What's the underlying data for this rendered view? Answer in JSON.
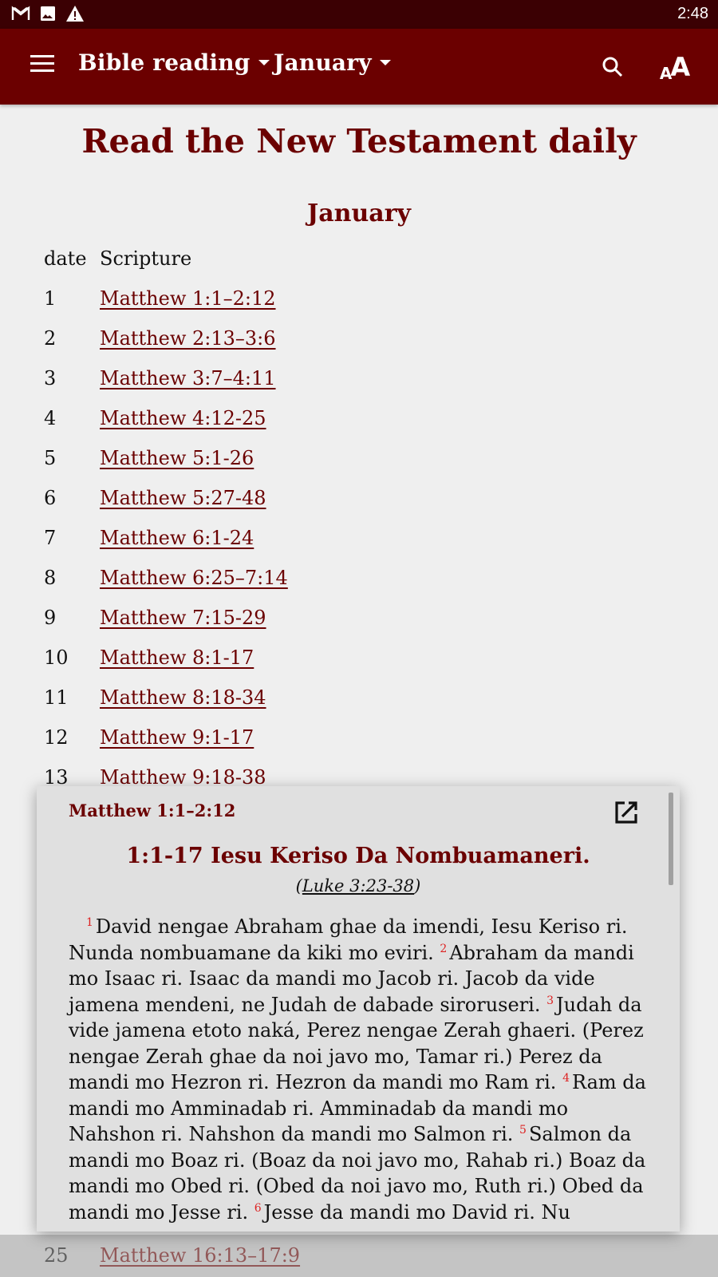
{
  "status_bar": {
    "icons": [
      "gmail-icon",
      "image-icon",
      "warning-icon"
    ],
    "time": "2:48"
  },
  "app_bar": {
    "book_dropdown": "Bible reading",
    "month_dropdown": "January",
    "actions": [
      "search-icon",
      "text-size-icon"
    ],
    "colors": {
      "primary": "#6b0000",
      "status": "#3b0003"
    }
  },
  "page": {
    "title": "Read the New Testament daily",
    "month": "January",
    "columns": {
      "date": "date",
      "scripture": "Scripture"
    },
    "rows": [
      {
        "date": "1",
        "ref": "Matthew 1:1–2:12"
      },
      {
        "date": "2",
        "ref": "Matthew 2:13–3:6"
      },
      {
        "date": "3",
        "ref": "Matthew 3:7–4:11"
      },
      {
        "date": "4",
        "ref": "Matthew 4:12-25"
      },
      {
        "date": "5",
        "ref": "Matthew 5:1-26"
      },
      {
        "date": "6",
        "ref": "Matthew 5:27-48"
      },
      {
        "date": "7",
        "ref": "Matthew 6:1-24"
      },
      {
        "date": "8",
        "ref": "Matthew 6:25–7:14"
      },
      {
        "date": "9",
        "ref": "Matthew 7:15-29"
      },
      {
        "date": "10",
        "ref": "Matthew 8:1-17"
      },
      {
        "date": "11",
        "ref": "Matthew 8:18-34"
      },
      {
        "date": "12",
        "ref": "Matthew 9:1-17"
      },
      {
        "date": "13",
        "ref": "Matthew 9:18-38"
      }
    ],
    "partially_hidden_row": {
      "date": "25",
      "ref": "Matthew 16:13–17:9"
    }
  },
  "popup": {
    "reference": "Matthew 1:1–2:12",
    "section_title": "1:1-17 Iesu Keriso Da Nombuamaneri.",
    "parallel_open": "(",
    "parallel_ref": "Luke 3:23-38",
    "parallel_close": ")",
    "verses": [
      {
        "num": "1",
        "text": "David nengae Abraham ghae da imendi, Iesu Keriso ri. Nunda nombuamane da kiki mo eviri. "
      },
      {
        "num": "2",
        "text": "Abraham da mandi mo Isaac ri. Isaac da mandi mo Jacob ri. Jacob da vide jamena mendeni, ne Judah de dabade siroruseri. "
      },
      {
        "num": "3",
        "text": "Judah da vide jamena etoto naká, Perez nengae Zerah ghaeri. (Perez nengae Zerah ghae da noi javo mo, Tamar ri.) Perez da mandi mo Hezron ri. Hezron da mandi mo Ram ri. "
      },
      {
        "num": "4",
        "text": "Ram da mandi mo Amminadab ri. Amminadab da mandi mo Nahshon ri. Nahshon da mandi mo Salmon ri. "
      },
      {
        "num": "5",
        "text": "Salmon da mandi mo Boaz ri. (Boaz da noi javo mo, Rahab ri.) Boaz da mandi mo Obed ri. (Obed da noi javo mo, Ruth ri.) Obed da mandi mo Jesse ri. "
      },
      {
        "num": "6",
        "text": "Jesse da mandi mo David ri. Nu"
      }
    ]
  }
}
